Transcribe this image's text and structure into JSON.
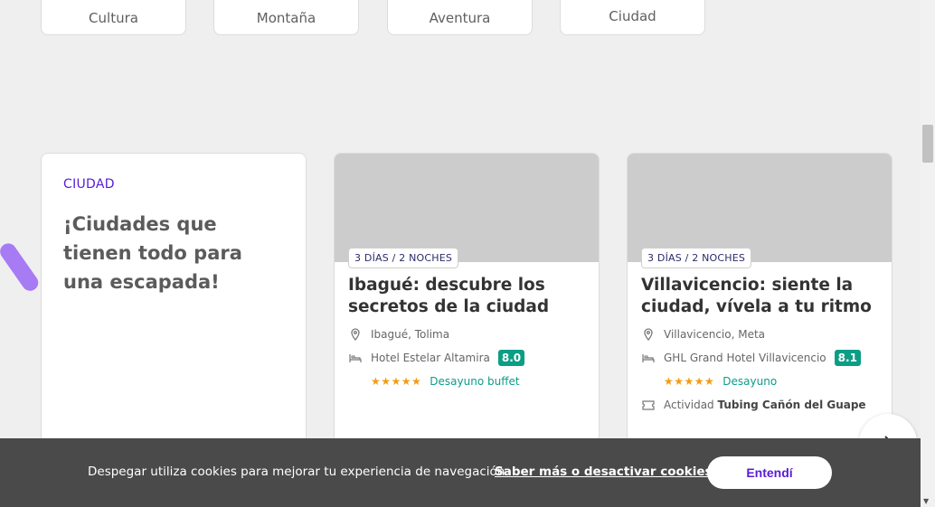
{
  "categories": [
    "Cultura",
    "Montaña",
    "Aventura",
    "Ciudad"
  ],
  "intro": {
    "tag": "CIUDAD",
    "title": "¡Ciudades que tienen todo para una escapada!"
  },
  "cards": [
    {
      "duration": "3 DÍAS / 2 NOCHES",
      "title": "Ibagué: descubre los secretos de la ciudad",
      "location": "Ibagué, Tolima",
      "hotel": "Hotel Estelar Altamira",
      "score": "8.0",
      "stars": "★★★★★",
      "meal": "Desayuno buffet"
    },
    {
      "duration": "3 DÍAS / 2 NOCHES",
      "title": "Villavicencio: siente la ciudad, vívela a tu ritmo",
      "location": "Villavicencio, Meta",
      "hotel": "GHL Grand Hotel Villavicencio",
      "score": "8.1",
      "stars": "★★★★★",
      "meal": "Desayuno",
      "activity_prefix": "Actividad",
      "activity_name": "Tubing Cañón del Guape"
    }
  ],
  "cookie": {
    "message": "Despegar utiliza cookies para mejorar tu experiencia de navegación.",
    "link": "Saber más o desactivar cookies.",
    "button": "Entendí"
  },
  "colors": {
    "accent": "#5a1bd6",
    "score_bg": "#0b9e85",
    "stars": "#f39c12",
    "banner_bg": "#4a4a4a"
  }
}
